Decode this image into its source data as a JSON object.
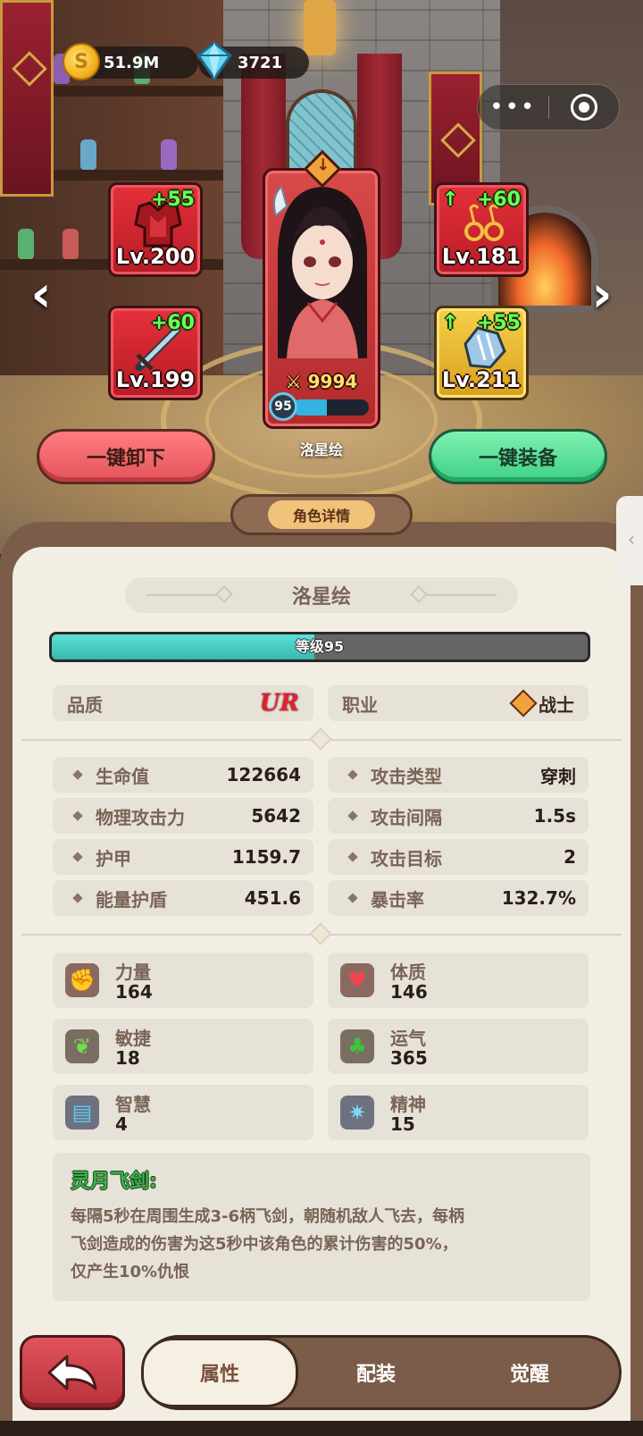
{
  "currency": {
    "gold": "51.9M",
    "gems": "3721"
  },
  "equipment": [
    {
      "slot": "armor",
      "plus": "+55",
      "level": "Lv.200",
      "upgrade_arrow": false,
      "rarity": "red"
    },
    {
      "slot": "weapon",
      "plus": "+60",
      "level": "Lv.199",
      "upgrade_arrow": false,
      "rarity": "red"
    },
    {
      "slot": "earrings",
      "plus": "+60",
      "level": "Lv.181",
      "upgrade_arrow": true,
      "rarity": "red"
    },
    {
      "slot": "gauntlet",
      "plus": "+55",
      "level": "Lv.211",
      "upgrade_arrow": true,
      "rarity": "gold"
    }
  ],
  "hero": {
    "name": "洛星绘",
    "power": "9994",
    "level": "95",
    "level_progress": 0.45
  },
  "actions": {
    "unequip_all": "一键卸下",
    "equip_all": "一键装备"
  },
  "panel": {
    "tab_label": "角色详情",
    "hero_name": "洛星绘",
    "level_text": "等级95",
    "level_progress": 0.49,
    "quality_label": "品质",
    "quality_value": "UR",
    "class_label": "职业",
    "class_value": "战士"
  },
  "stats_left": [
    {
      "label": "生命值",
      "value": "122664"
    },
    {
      "label": "物理攻击力",
      "value": "5642"
    },
    {
      "label": "护甲",
      "value": "1159.7"
    },
    {
      "label": "能量护盾",
      "value": "451.6"
    }
  ],
  "stats_right": [
    {
      "label": "攻击类型",
      "value": "穿刺"
    },
    {
      "label": "攻击间隔",
      "value": "1.5s"
    },
    {
      "label": "攻击目标",
      "value": "2"
    },
    {
      "label": "暴击率",
      "value": "132.7%"
    }
  ],
  "attributes": [
    {
      "name": "力量",
      "value": "164",
      "icon": "fist-icon"
    },
    {
      "name": "体质",
      "value": "146",
      "icon": "heart-icon"
    },
    {
      "name": "敏捷",
      "value": "18",
      "icon": "wing-icon"
    },
    {
      "name": "运气",
      "value": "365",
      "icon": "clover-icon"
    },
    {
      "name": "智慧",
      "value": "4",
      "icon": "book-icon"
    },
    {
      "name": "精神",
      "value": "15",
      "icon": "spirit-icon"
    }
  ],
  "skill": {
    "title": "灵月飞剑:",
    "line1": "每隔5秒在周围生成3-6柄飞剑，朝随机敌人飞去，每柄",
    "line2": "飞剑造成的伤害为这5秒中该角色的累计伤害的50%，",
    "line3": "仅产生10%仇恨"
  },
  "tabs": [
    {
      "label": "属性",
      "active": true
    },
    {
      "label": "配装",
      "active": false
    },
    {
      "label": "觉醒",
      "active": false
    }
  ],
  "colors": {
    "slot_red": "#d62a33",
    "slot_gold": "#f2c23e",
    "level_fill": "#4ccfc5",
    "unequip": "#ef6a6f",
    "equip": "#58dc98",
    "panel_bg": "#f2eee4",
    "frame_brown": "#7a5c48"
  }
}
